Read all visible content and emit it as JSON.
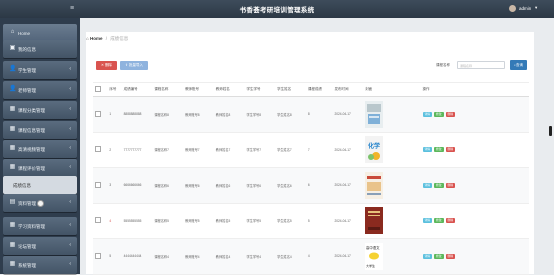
{
  "header": {
    "title": "书香荟考研培训管理系统",
    "username": "admin",
    "caret": "▾"
  },
  "sidebar": {
    "items": [
      {
        "label": "Home",
        "icon": "home-icon",
        "glyph": "⌂"
      },
      {
        "label": "我的信息",
        "icon": "id-card-icon",
        "glyph": "▣"
      },
      {
        "label": "学生管理",
        "icon": "users-icon",
        "glyph": "👤"
      },
      {
        "label": "老师管理",
        "icon": "user-icon",
        "glyph": "👤"
      },
      {
        "label": "课程分类管理",
        "icon": "grid-icon",
        "glyph": "▦"
      },
      {
        "label": "课程信息管理",
        "icon": "grid-icon",
        "glyph": "▦"
      },
      {
        "label": "高清视频管理",
        "icon": "grid-icon",
        "glyph": "▦"
      },
      {
        "label": "课程评价管理",
        "icon": "grid-icon",
        "glyph": "▦"
      },
      {
        "label": "试题管理",
        "icon": "grid-icon",
        "glyph": "▦"
      },
      {
        "label": "成绩信息",
        "icon": "",
        "glyph": ""
      },
      {
        "label": "资料管理",
        "icon": "folder-icon",
        "glyph": "▤"
      },
      {
        "label": "学习资料管理",
        "icon": "grid-icon",
        "glyph": "▦"
      },
      {
        "label": "论坛管理",
        "icon": "grid-icon",
        "glyph": "▦"
      },
      {
        "label": "系统管理",
        "icon": "grid-icon",
        "glyph": "▦"
      }
    ]
  },
  "breadcrumb": {
    "home": "Home",
    "sep": "/",
    "current": "成绩信息"
  },
  "toolbar": {
    "delete_label": "删除",
    "import_label": "批量导入",
    "search_label": "课程名称",
    "search_placeholder": "课程名称",
    "search_button": "查询"
  },
  "table": {
    "headers": [
      "",
      "序号",
      "成绩编号",
      "课程名称",
      "教师账号",
      "教师姓名",
      "学生学号",
      "学生姓名",
      "课程成绩",
      "发布时间",
      "封面",
      "操作"
    ],
    "rows": [
      {
        "idx": "1",
        "code": "8888888888",
        "course": "课程名称8",
        "tacct": "教师账号8",
        "tname": "教师姓名8",
        "sno": "学生学号8",
        "sname": "学生姓名8",
        "score": "8",
        "date": "2024-04-17"
      },
      {
        "idx": "2",
        "code": "7777777777",
        "course": "课程名称7",
        "tacct": "教师账号7",
        "tname": "教师姓名7",
        "sno": "学生学号7",
        "sname": "学生姓名7",
        "score": "7",
        "date": "2024-04-17"
      },
      {
        "idx": "3",
        "code": "6666666666",
        "course": "课程名称6",
        "tacct": "教师账号6",
        "tname": "教师姓名6",
        "sno": "学生学号6",
        "sname": "学生姓名6",
        "score": "6",
        "date": "2024-04-17"
      },
      {
        "idx": "4",
        "code": "5555555555",
        "course": "课程名称5",
        "tacct": "教师账号5",
        "tname": "教师姓名5",
        "sno": "学生学号5",
        "sname": "学生姓名5",
        "score": "5",
        "date": "2024-04-17"
      },
      {
        "idx": "5",
        "code": "4444444444",
        "course": "课程名称4",
        "tacct": "教师账号4",
        "tname": "教师姓名4",
        "sno": "学生学号4",
        "sname": "学生姓名4",
        "score": "4",
        "date": "2024-04-17"
      }
    ],
    "actions": {
      "view": "详情",
      "edit": "修改",
      "delete": "删除"
    },
    "cover_texts": {
      "r2": "化学",
      "r5_line1": "高中语文",
      "r5_line2": "大学生"
    }
  },
  "colors": {
    "topbar": "#34414f",
    "sidebar": "#2f3d4d",
    "danger": "#d9534f",
    "primary": "#337ab7",
    "info": "#5bc0de",
    "success": "#5cb85c"
  }
}
